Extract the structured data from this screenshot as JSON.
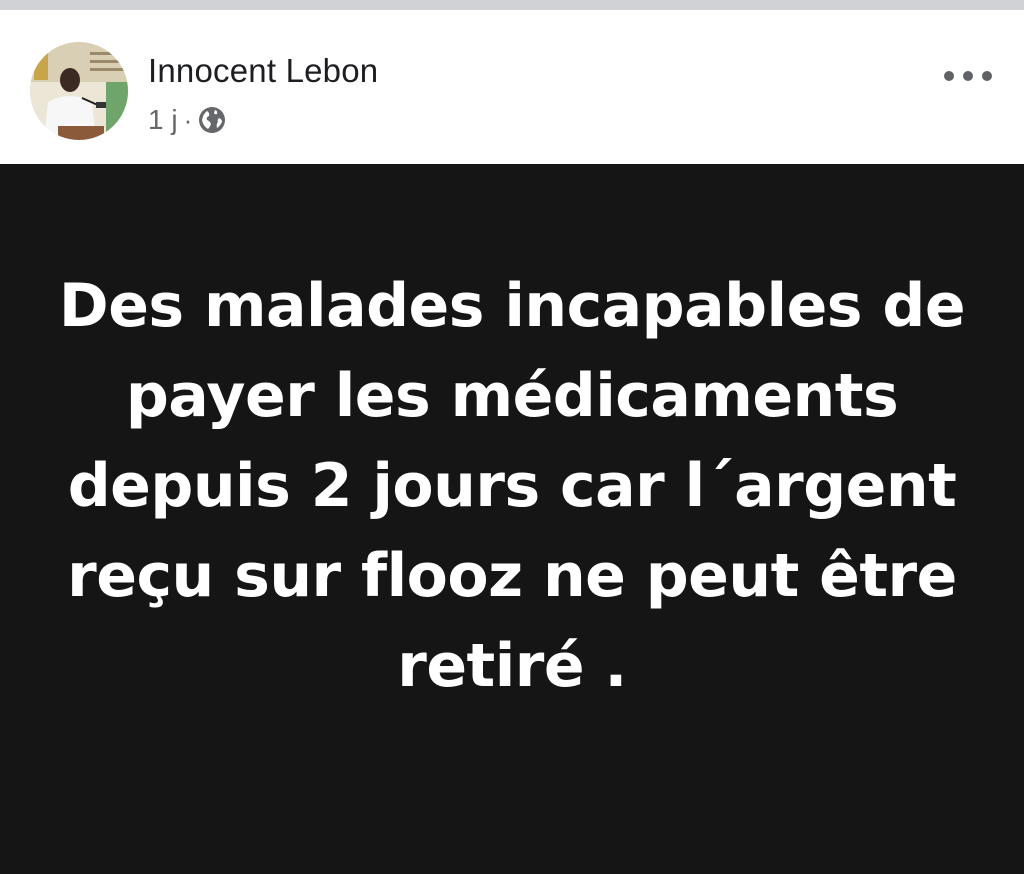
{
  "post": {
    "author": "Innocent Lebon",
    "time": "1 j",
    "separator": "·",
    "privacy_icon": "globe-icon",
    "more_icon": "more-options-icon",
    "text": "Des malades incapables de payer les médicaments depuis 2 jours car l´argent reçu sur flooz ne peut être retiré ."
  },
  "colors": {
    "post_background": "#151515",
    "post_text": "#ffffff",
    "meta_text": "#65676b"
  }
}
